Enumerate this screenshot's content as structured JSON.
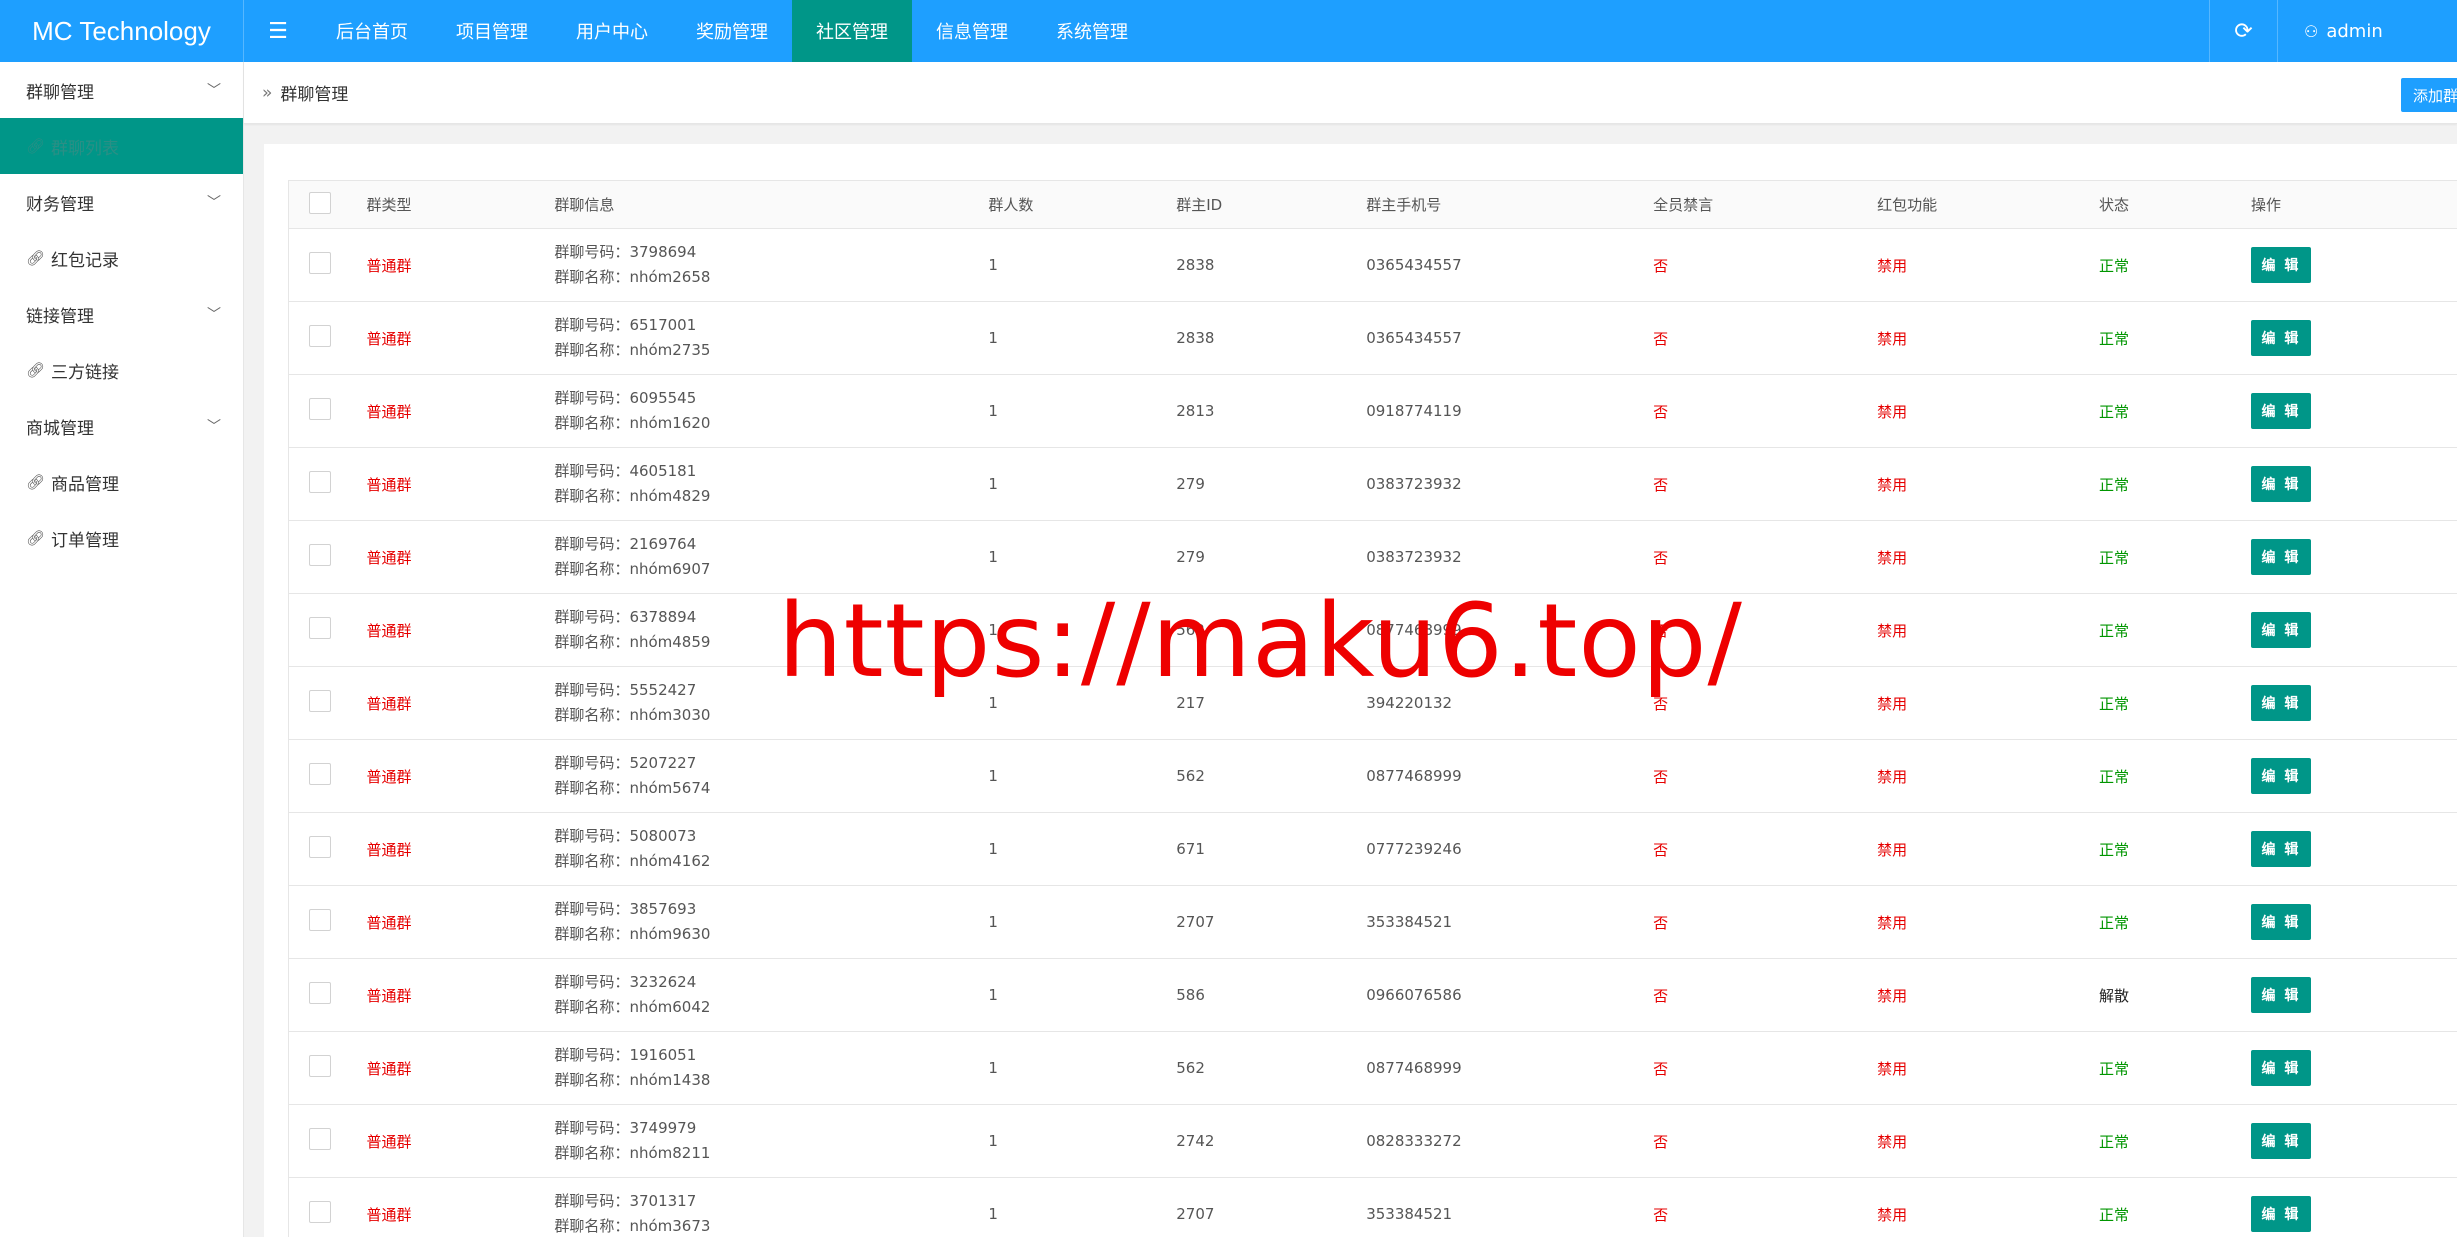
{
  "header": {
    "logo": "MC Technology",
    "menu_icon": "hamburger-icon",
    "nav": [
      {
        "label": "后台首页",
        "active": false
      },
      {
        "label": "项目管理",
        "active": false
      },
      {
        "label": "用户中心",
        "active": false
      },
      {
        "label": "奖励管理",
        "active": false
      },
      {
        "label": "社区管理",
        "active": true
      },
      {
        "label": "信息管理",
        "active": false
      },
      {
        "label": "系统管理",
        "active": false
      }
    ],
    "refresh_icon": "refresh-icon",
    "user_label": "admin"
  },
  "sidebar": {
    "groups": [
      {
        "label": "群聊管理",
        "items": [
          {
            "label": "群聊列表",
            "active": true
          }
        ]
      },
      {
        "label": "财务管理",
        "items": [
          {
            "label": "红包记录",
            "active": false
          }
        ]
      },
      {
        "label": "链接管理",
        "items": [
          {
            "label": "三方链接",
            "active": false
          }
        ]
      },
      {
        "label": "商城管理",
        "items": [
          {
            "label": "商品管理",
            "active": false
          },
          {
            "label": "订单管理",
            "active": false
          }
        ]
      }
    ]
  },
  "breadcrumb": {
    "title": "群聊管理",
    "add_button": "添加群聊"
  },
  "table": {
    "headers": [
      "群类型",
      "群聊信息",
      "群人数",
      "群主ID",
      "群主手机号",
      "全员禁言",
      "红包功能",
      "状态",
      "操作"
    ],
    "number_label": "群聊号码：",
    "name_label": "群聊名称：",
    "edit_label": "编 辑",
    "rows": [
      {
        "type": "普通群",
        "number": "3798694",
        "name": "nhóm2658",
        "members": "1",
        "owner_id": "2838",
        "phone": "0365434557",
        "mute": "否",
        "redpacket": "禁用",
        "status": "正常"
      },
      {
        "type": "普通群",
        "number": "6517001",
        "name": "nhóm2735",
        "members": "1",
        "owner_id": "2838",
        "phone": "0365434557",
        "mute": "否",
        "redpacket": "禁用",
        "status": "正常"
      },
      {
        "type": "普通群",
        "number": "6095545",
        "name": "nhóm1620",
        "members": "1",
        "owner_id": "2813",
        "phone": "0918774119",
        "mute": "否",
        "redpacket": "禁用",
        "status": "正常"
      },
      {
        "type": "普通群",
        "number": "4605181",
        "name": "nhóm4829",
        "members": "1",
        "owner_id": "279",
        "phone": "0383723932",
        "mute": "否",
        "redpacket": "禁用",
        "status": "正常"
      },
      {
        "type": "普通群",
        "number": "2169764",
        "name": "nhóm6907",
        "members": "1",
        "owner_id": "279",
        "phone": "0383723932",
        "mute": "否",
        "redpacket": "禁用",
        "status": "正常"
      },
      {
        "type": "普通群",
        "number": "6378894",
        "name": "nhóm4859",
        "members": "1",
        "owner_id": "562",
        "phone": "0877468999",
        "mute": "否",
        "redpacket": "禁用",
        "status": "正常"
      },
      {
        "type": "普通群",
        "number": "5552427",
        "name": "nhóm3030",
        "members": "1",
        "owner_id": "217",
        "phone": "394220132",
        "mute": "否",
        "redpacket": "禁用",
        "status": "正常"
      },
      {
        "type": "普通群",
        "number": "5207227",
        "name": "nhóm5674",
        "members": "1",
        "owner_id": "562",
        "phone": "0877468999",
        "mute": "否",
        "redpacket": "禁用",
        "status": "正常"
      },
      {
        "type": "普通群",
        "number": "5080073",
        "name": "nhóm4162",
        "members": "1",
        "owner_id": "671",
        "phone": "0777239246",
        "mute": "否",
        "redpacket": "禁用",
        "status": "正常"
      },
      {
        "type": "普通群",
        "number": "3857693",
        "name": "nhóm9630",
        "members": "1",
        "owner_id": "2707",
        "phone": "353384521",
        "mute": "否",
        "redpacket": "禁用",
        "status": "正常"
      },
      {
        "type": "普通群",
        "number": "3232624",
        "name": "nhóm6042",
        "members": "1",
        "owner_id": "586",
        "phone": "0966076586",
        "mute": "否",
        "redpacket": "禁用",
        "status": "解散"
      },
      {
        "type": "普通群",
        "number": "1916051",
        "name": "nhóm1438",
        "members": "1",
        "owner_id": "562",
        "phone": "0877468999",
        "mute": "否",
        "redpacket": "禁用",
        "status": "正常"
      },
      {
        "type": "普通群",
        "number": "3749979",
        "name": "nhóm8211",
        "members": "1",
        "owner_id": "2742",
        "phone": "0828333272",
        "mute": "否",
        "redpacket": "禁用",
        "status": "正常"
      },
      {
        "type": "普通群",
        "number": "3701317",
        "name": "nhóm3673",
        "members": "1",
        "owner_id": "2707",
        "phone": "353384521",
        "mute": "否",
        "redpacket": "禁用",
        "status": "正常"
      }
    ]
  },
  "watermark": "https://maku6.top/",
  "colors": {
    "header": "#1e9fff",
    "active": "#009688",
    "danger": "#e60000",
    "success": "#009600"
  }
}
